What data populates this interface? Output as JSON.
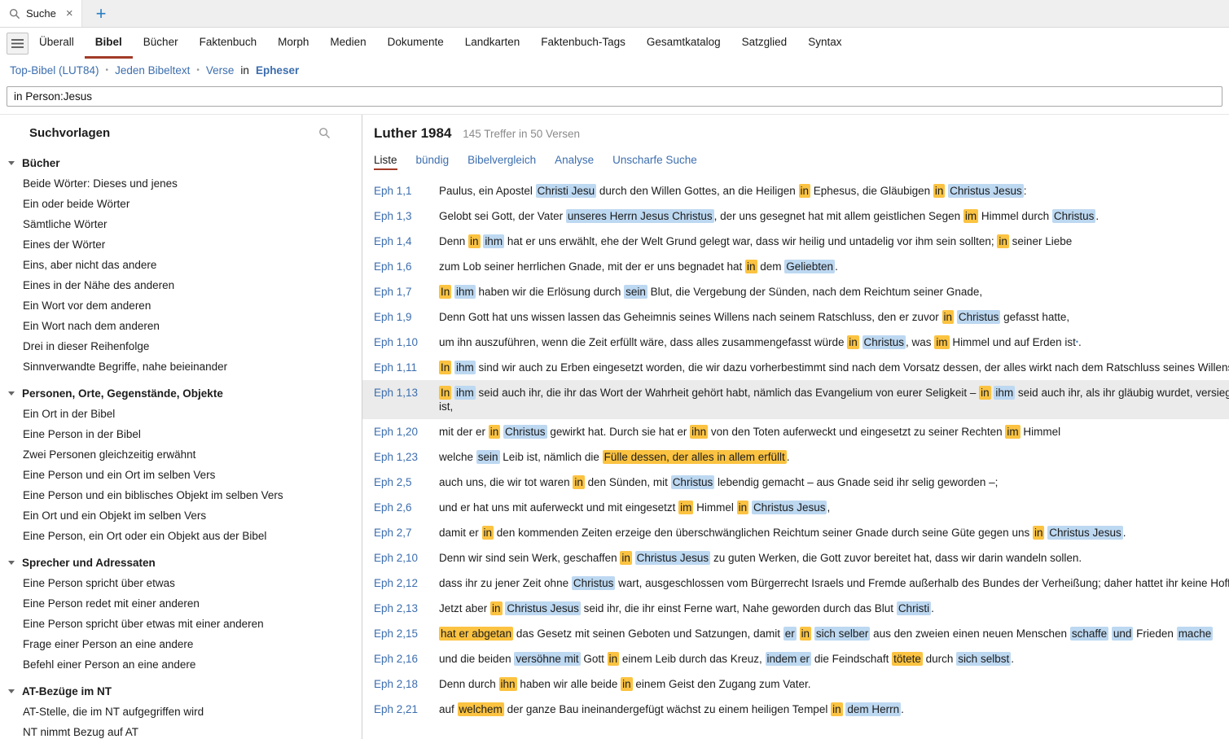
{
  "window": {
    "tab": {
      "label": "Suche",
      "close": "×"
    },
    "new_tab": "+"
  },
  "toolbar": {
    "items": [
      {
        "label": "Überall",
        "active": false
      },
      {
        "label": "Bibel",
        "active": true
      },
      {
        "label": "Bücher",
        "active": false
      },
      {
        "label": "Faktenbuch",
        "active": false
      },
      {
        "label": "Morph",
        "active": false
      },
      {
        "label": "Medien",
        "active": false
      },
      {
        "label": "Dokumente",
        "active": false
      },
      {
        "label": "Landkarten",
        "active": false
      },
      {
        "label": "Faktenbuch-Tags",
        "active": false
      },
      {
        "label": "Gesamtkatalog",
        "active": false
      },
      {
        "label": "Satzglied",
        "active": false
      },
      {
        "label": "Syntax",
        "active": false
      }
    ]
  },
  "breadcrumb": {
    "parts": [
      {
        "label": "Top-Bibel (LUT84)",
        "type": "link"
      },
      {
        "label": "•",
        "type": "sep"
      },
      {
        "label": "Jeden Bibeltext",
        "type": "link"
      },
      {
        "label": "•",
        "type": "sep"
      },
      {
        "label": "Verse",
        "type": "link"
      },
      {
        "label": "in",
        "type": "text"
      },
      {
        "label": "Epheser",
        "type": "link-strong"
      }
    ]
  },
  "search": {
    "value": "in Person:Jesus"
  },
  "sidebar": {
    "title": "Suchvorlagen",
    "sections": [
      {
        "title": "Bücher",
        "items": [
          "Beide Wörter: Dieses und jenes",
          "Ein oder beide Wörter",
          "Sämtliche Wörter",
          "Eines der Wörter",
          "Eins, aber nicht das andere",
          "Eines in der Nähe des anderen",
          "Ein Wort vor dem anderen",
          "Ein Wort nach dem anderen",
          "Drei in dieser Reihenfolge",
          "Sinnverwandte Begriffe, nahe beieinander"
        ]
      },
      {
        "title": "Personen, Orte, Gegenstände, Objekte",
        "items": [
          "Ein Ort in der Bibel",
          "Eine Person in der Bibel",
          "Zwei Personen gleichzeitig erwähnt",
          "Eine Person und ein Ort im selben Vers",
          "Eine Person und ein biblisches Objekt im selben Vers",
          "Ein Ort und ein Objekt im selben Vers",
          "Eine Person, ein Ort oder ein Objekt aus der Bibel"
        ]
      },
      {
        "title": "Sprecher und Adressaten",
        "items": [
          "Eine Person spricht über etwas",
          "Eine Person redet mit einer anderen",
          "Eine Person spricht über etwas mit einer anderen",
          "Frage einer Person an eine andere",
          "Befehl einer Person an eine andere"
        ]
      },
      {
        "title": "AT-Bezüge im NT",
        "items": [
          "AT-Stelle, die im NT aufgegriffen wird",
          "NT nimmt Bezug auf AT"
        ]
      }
    ]
  },
  "results": {
    "bible": "Luther 1984",
    "summary": "145 Treffer in 50 Versen",
    "view_tabs": [
      {
        "label": "Liste",
        "active": true
      },
      {
        "label": "bündig",
        "active": false
      },
      {
        "label": "Bibelvergleich",
        "active": false
      },
      {
        "label": "Analyse",
        "active": false
      },
      {
        "label": "Unscharfe Suche",
        "active": false
      }
    ],
    "verses": [
      {
        "ref": "Eph 1,1",
        "selected": false,
        "lines": [
          [
            {
              "t": "Paulus, ein Apostel "
            },
            {
              "t": "Christi Jesu",
              "h": "b"
            },
            {
              "t": " durch den Willen Gottes, an die Heiligen "
            },
            {
              "t": "in",
              "h": "y"
            },
            {
              "t": " Ephesus, die Gläubigen "
            },
            {
              "t": "in",
              "h": "y"
            },
            {
              "t": " "
            },
            {
              "t": "Christus Jesus",
              "h": "b"
            },
            {
              "t": ":"
            }
          ]
        ]
      },
      {
        "ref": "Eph 1,3",
        "selected": false,
        "lines": [
          [
            {
              "t": "Gelobt sei Gott, der Vater "
            },
            {
              "t": "unseres Herrn Jesus Christus",
              "h": "b"
            },
            {
              "t": ", der uns gesegnet hat mit allem geistlichen Segen "
            },
            {
              "t": "im",
              "h": "y"
            },
            {
              "t": " Himmel durch "
            },
            {
              "t": "Christus",
              "h": "b"
            },
            {
              "t": "."
            }
          ]
        ]
      },
      {
        "ref": "Eph 1,4",
        "selected": false,
        "lines": [
          [
            {
              "t": "Denn "
            },
            {
              "t": "in",
              "h": "y"
            },
            {
              "t": " "
            },
            {
              "t": "ihm",
              "h": "b"
            },
            {
              "t": " hat er uns erwählt, ehe der Welt Grund gelegt war, dass wir heilig und untadelig vor ihm sein sollten; "
            },
            {
              "t": "in",
              "h": "y"
            },
            {
              "t": " seiner Liebe"
            }
          ]
        ]
      },
      {
        "ref": "Eph 1,6",
        "selected": false,
        "lines": [
          [
            {
              "t": "zum Lob seiner herrlichen Gnade, mit der er uns begnadet hat "
            },
            {
              "t": "in",
              "h": "y"
            },
            {
              "t": " dem "
            },
            {
              "t": "Geliebten",
              "h": "b"
            },
            {
              "t": "."
            }
          ]
        ]
      },
      {
        "ref": "Eph 1,7",
        "selected": false,
        "lines": [
          [
            {
              "t": "In",
              "h": "y"
            },
            {
              "t": " "
            },
            {
              "t": "ihm",
              "h": "b"
            },
            {
              "t": " haben wir die Erlösung durch "
            },
            {
              "t": "sein",
              "h": "b"
            },
            {
              "t": " Blut, die Vergebung der Sünden, nach dem Reichtum seiner Gnade,"
            }
          ]
        ]
      },
      {
        "ref": "Eph 1,9",
        "selected": false,
        "lines": [
          [
            {
              "t": "Denn Gott hat uns wissen lassen das Geheimnis seines Willens nach seinem Ratschluss, den er zuvor "
            },
            {
              "t": "in",
              "h": "y"
            },
            {
              "t": " "
            },
            {
              "t": "Christus",
              "h": "b"
            },
            {
              "t": " gefasst hatte,"
            }
          ]
        ]
      },
      {
        "ref": "Eph 1,10",
        "selected": false,
        "lines": [
          [
            {
              "t": "um ihn auszuführen, wenn die Zeit erfüllt wäre, dass alles zusammengefasst würde "
            },
            {
              "t": "in",
              "h": "y"
            },
            {
              "t": " "
            },
            {
              "t": "Christus",
              "h": "b"
            },
            {
              "t": ", was "
            },
            {
              "t": "im",
              "h": "y"
            },
            {
              "t": " Himmel und auf Erden ist"
            },
            {
              "t": "•",
              "h": "m"
            },
            {
              "t": "."
            }
          ]
        ]
      },
      {
        "ref": "Eph 1,11",
        "selected": false,
        "lines": [
          [
            {
              "t": "In",
              "h": "y"
            },
            {
              "t": " "
            },
            {
              "t": "ihm",
              "h": "b"
            },
            {
              "t": " sind wir auch zu Erben eingesetzt worden, die wir dazu vorherbestimmt sind nach dem Vorsatz dessen, der alles wirkt nach dem Ratschluss seines Willens;"
            }
          ]
        ]
      },
      {
        "ref": "Eph 1,13",
        "selected": true,
        "lines": [
          [
            {
              "t": "In",
              "h": "y"
            },
            {
              "t": " "
            },
            {
              "t": "ihm",
              "h": "b"
            },
            {
              "t": " seid auch ihr, die ihr das Wort der Wahrheit gehört habt, nämlich das Evangelium von eurer Seligkeit – "
            },
            {
              "t": "in",
              "h": "y"
            },
            {
              "t": " "
            },
            {
              "t": "ihm",
              "h": "b"
            },
            {
              "t": " seid auch ihr, als ihr gläubig wurdet, versiegelt worden mit dem Heiligen Geist, der verheißen"
            }
          ],
          [
            {
              "t": "ist,"
            }
          ]
        ]
      },
      {
        "ref": "Eph 1,20",
        "selected": false,
        "lines": [
          [
            {
              "t": "mit der er "
            },
            {
              "t": "in",
              "h": "y"
            },
            {
              "t": " "
            },
            {
              "t": "Christus",
              "h": "b"
            },
            {
              "t": " gewirkt hat. Durch sie hat er "
            },
            {
              "t": "ihn",
              "h": "y"
            },
            {
              "t": " von den Toten auferweckt und eingesetzt zu seiner Rechten "
            },
            {
              "t": "im",
              "h": "y"
            },
            {
              "t": " Himmel"
            }
          ]
        ]
      },
      {
        "ref": "Eph 1,23",
        "selected": false,
        "lines": [
          [
            {
              "t": "welche "
            },
            {
              "t": "sein",
              "h": "b"
            },
            {
              "t": " Leib ist, nämlich die "
            },
            {
              "t": "Fülle dessen, der alles in allem erfüllt",
              "h": "y"
            },
            {
              "t": "."
            }
          ]
        ]
      },
      {
        "ref": "Eph 2,5",
        "selected": false,
        "lines": [
          [
            {
              "t": "auch uns, die wir tot waren "
            },
            {
              "t": "in",
              "h": "y"
            },
            {
              "t": " den Sünden, mit "
            },
            {
              "t": "Christus",
              "h": "b"
            },
            {
              "t": " lebendig gemacht – aus Gnade seid ihr selig geworden –;"
            }
          ]
        ]
      },
      {
        "ref": "Eph 2,6",
        "selected": false,
        "lines": [
          [
            {
              "t": "und er hat uns mit auferweckt und mit eingesetzt "
            },
            {
              "t": "im",
              "h": "y"
            },
            {
              "t": " Himmel "
            },
            {
              "t": "in",
              "h": "y"
            },
            {
              "t": " "
            },
            {
              "t": "Christus Jesus",
              "h": "b"
            },
            {
              "t": ","
            }
          ]
        ]
      },
      {
        "ref": "Eph 2,7",
        "selected": false,
        "lines": [
          [
            {
              "t": "damit er "
            },
            {
              "t": "in",
              "h": "y"
            },
            {
              "t": " den kommenden Zeiten erzeige den überschwänglichen Reichtum seiner Gnade durch seine Güte gegen uns "
            },
            {
              "t": "in",
              "h": "y"
            },
            {
              "t": " "
            },
            {
              "t": "Christus Jesus",
              "h": "b"
            },
            {
              "t": "."
            }
          ]
        ]
      },
      {
        "ref": "Eph 2,10",
        "selected": false,
        "lines": [
          [
            {
              "t": "Denn wir sind sein Werk, geschaffen "
            },
            {
              "t": "in",
              "h": "y"
            },
            {
              "t": " "
            },
            {
              "t": "Christus Jesus",
              "h": "b"
            },
            {
              "t": " zu guten Werken, die Gott zuvor bereitet hat, dass wir darin wandeln sollen."
            }
          ]
        ]
      },
      {
        "ref": "Eph 2,12",
        "selected": false,
        "lines": [
          [
            {
              "t": "dass ihr zu jener Zeit ohne "
            },
            {
              "t": "Christus",
              "h": "b"
            },
            {
              "t": " wart, ausgeschlossen vom Bürgerrecht Israels und Fremde außerhalb des Bundes der Verheißung; daher hattet ihr keine Hoffnung und"
            }
          ]
        ]
      },
      {
        "ref": "Eph 2,13",
        "selected": false,
        "lines": [
          [
            {
              "t": "Jetzt aber "
            },
            {
              "t": "in",
              "h": "y"
            },
            {
              "t": " "
            },
            {
              "t": "Christus Jesus",
              "h": "b"
            },
            {
              "t": " seid ihr, die ihr einst Ferne wart, Nahe geworden durch das Blut "
            },
            {
              "t": "Christi",
              "h": "b"
            },
            {
              "t": "."
            }
          ]
        ]
      },
      {
        "ref": "Eph 2,15",
        "selected": false,
        "lines": [
          [
            {
              "t": "hat er abgetan",
              "h": "y"
            },
            {
              "t": " das Gesetz mit seinen Geboten und Satzungen, damit "
            },
            {
              "t": "er",
              "h": "b"
            },
            {
              "t": " "
            },
            {
              "t": "in",
              "h": "y"
            },
            {
              "t": " "
            },
            {
              "t": "sich selber",
              "h": "b"
            },
            {
              "t": " aus den zweien einen neuen Menschen "
            },
            {
              "t": "schaffe",
              "h": "b"
            },
            {
              "t": " "
            },
            {
              "t": "und",
              "h": "b"
            },
            {
              "t": " Frieden "
            },
            {
              "t": "mache",
              "h": "b"
            }
          ]
        ]
      },
      {
        "ref": "Eph 2,16",
        "selected": false,
        "lines": [
          [
            {
              "t": "und die beiden "
            },
            {
              "t": "versöhne mit",
              "h": "b"
            },
            {
              "t": " Gott "
            },
            {
              "t": "in",
              "h": "y"
            },
            {
              "t": " einem Leib durch das Kreuz, "
            },
            {
              "t": "indem er",
              "h": "b"
            },
            {
              "t": " die Feindschaft "
            },
            {
              "t": "tötete",
              "h": "y"
            },
            {
              "t": " durch "
            },
            {
              "t": "sich selbst",
              "h": "b"
            },
            {
              "t": "."
            }
          ]
        ]
      },
      {
        "ref": "Eph 2,18",
        "selected": false,
        "lines": [
          [
            {
              "t": "Denn durch "
            },
            {
              "t": "ihn",
              "h": "y"
            },
            {
              "t": " haben wir alle beide "
            },
            {
              "t": "in",
              "h": "y"
            },
            {
              "t": " einem Geist den Zugang zum Vater."
            }
          ]
        ]
      },
      {
        "ref": "Eph 2,21",
        "selected": false,
        "lines": [
          [
            {
              "t": "auf "
            },
            {
              "t": "welchem",
              "h": "y"
            },
            {
              "t": " der ganze Bau ineinandergefügt wächst zu einem heiligen Tempel "
            },
            {
              "t": "in",
              "h": "y"
            },
            {
              "t": " "
            },
            {
              "t": "dem Herrn",
              "h": "b"
            },
            {
              "t": "."
            }
          ]
        ]
      }
    ]
  },
  "colors": {
    "highlight_term": "#fbc341",
    "highlight_person": "#bdd8f1",
    "active_underline": "#a23b28",
    "link": "#3c6eae",
    "selected_row": "#ebebeb",
    "new_tab_plus": "#2a7ec2"
  }
}
